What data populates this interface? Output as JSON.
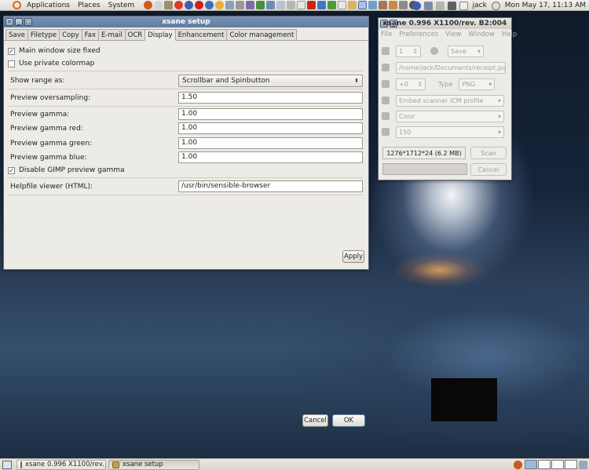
{
  "top_panel": {
    "menus": [
      "Applications",
      "Places",
      "System"
    ],
    "user": "jack",
    "clock": "Mon May 17, 11:13 AM"
  },
  "setup_window": {
    "title": "xsane setup",
    "tabs": [
      "Save",
      "Filetype",
      "Copy",
      "Fax",
      "E-mail",
      "OCR",
      "Display",
      "Enhancement",
      "Color management"
    ],
    "active_tab": "Display",
    "checkboxes": {
      "main_window_size_fixed": {
        "label": "Main window size fixed",
        "checked": true
      },
      "use_private_colormap": {
        "label": "Use private colormap",
        "checked": false
      },
      "disable_gimp_preview_gamma": {
        "label": "Disable GIMP preview gamma",
        "checked": true
      }
    },
    "show_range": {
      "label": "Show range as:",
      "value": "Scrollbar and Spinbutton"
    },
    "preview_oversampling": {
      "label": "Preview oversampling:",
      "value": "1.50"
    },
    "preview_gamma": {
      "label": "Preview gamma:",
      "value": "1.00"
    },
    "preview_gamma_red": {
      "label": "Preview gamma red:",
      "value": "1.00"
    },
    "preview_gamma_green": {
      "label": "Preview gamma green:",
      "value": "1.00"
    },
    "preview_gamma_blue": {
      "label": "Preview gamma blue:",
      "value": "1.00"
    },
    "helpfile_viewer": {
      "label": "Helpfile viewer (HTML):",
      "value": "/usr/bin/sensible-browser"
    },
    "apply_label": "Apply",
    "cancel_label": "Cancel",
    "ok_label": "OK"
  },
  "xsane_window": {
    "title": "xsane 0.996 X1100/rev. B2:004",
    "menus": [
      "File",
      "Preferences",
      "View",
      "Window",
      "Help"
    ],
    "copies": "1",
    "save_mode": "Save",
    "filename": "/home/jack/Documents/receipt.jpg",
    "offset": "+0",
    "type_label": "Type",
    "type_value": "PNG",
    "icm_profile": "Embed scanner ICM profile",
    "color_mode": "Color",
    "resolution": "150",
    "image_info": "1276*1712*24 (6.2 MB)",
    "scan_label": "Scan",
    "cancel_label": "Cancel"
  },
  "taskbar": {
    "tasks": [
      {
        "label": "xsane 0.996 X1100/rev..."
      },
      {
        "label": "xsane setup"
      }
    ]
  },
  "colors": {
    "titlebar_active": "#6f8aae",
    "window_bg": "#edebe6",
    "panel_bg": "#e4e2dc"
  }
}
